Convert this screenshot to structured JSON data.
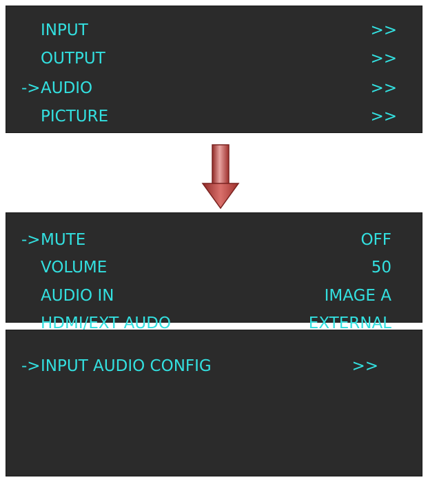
{
  "main_menu": {
    "items": [
      {
        "cursor": "",
        "label": "INPUT",
        "value": ">>"
      },
      {
        "cursor": "",
        "label": "OUTPUT",
        "value": ">>"
      },
      {
        "cursor": "->",
        "label": "AUDIO",
        "value": ">>"
      },
      {
        "cursor": "",
        "label": "PICTURE",
        "value": ">>"
      }
    ]
  },
  "transition_icon": "down-arrow-icon",
  "audio_menu": {
    "items": [
      {
        "cursor": "->",
        "label": "MUTE",
        "value": "OFF"
      },
      {
        "cursor": "",
        "label": "VOLUME",
        "value": "50"
      },
      {
        "cursor": "",
        "label": "AUDIO IN",
        "value": "IMAGE A"
      },
      {
        "cursor": "",
        "label": "HDMI/EXT AUDO",
        "value": "EXTERNAL"
      }
    ]
  },
  "config_menu": {
    "items": [
      {
        "cursor": "->",
        "label": "INPUT AUDIO CONFIG",
        "value": ">>"
      }
    ]
  },
  "colors": {
    "panel_bg": "#2b2b2b",
    "text": "#33e0e0",
    "arrow": "#c0504d"
  }
}
